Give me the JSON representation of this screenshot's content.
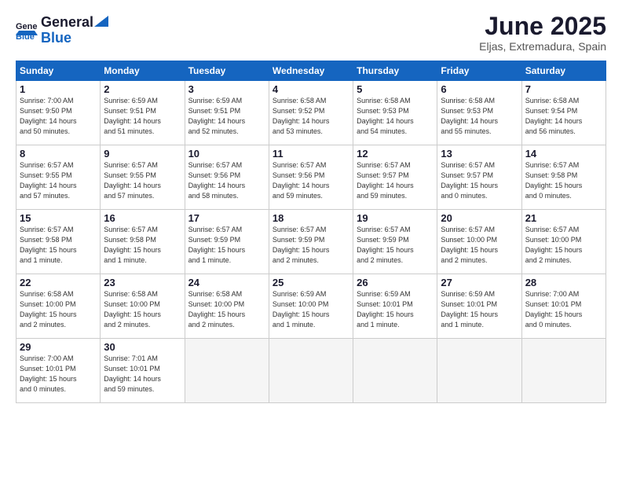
{
  "logo": {
    "general": "General",
    "blue": "Blue"
  },
  "title": "June 2025",
  "subtitle": "Eljas, Extremadura, Spain",
  "weekdays": [
    "Sunday",
    "Monday",
    "Tuesday",
    "Wednesday",
    "Thursday",
    "Friday",
    "Saturday"
  ],
  "weeks": [
    [
      {
        "day": "1",
        "info": "Sunrise: 7:00 AM\nSunset: 9:50 PM\nDaylight: 14 hours\nand 50 minutes."
      },
      {
        "day": "2",
        "info": "Sunrise: 6:59 AM\nSunset: 9:51 PM\nDaylight: 14 hours\nand 51 minutes."
      },
      {
        "day": "3",
        "info": "Sunrise: 6:59 AM\nSunset: 9:51 PM\nDaylight: 14 hours\nand 52 minutes."
      },
      {
        "day": "4",
        "info": "Sunrise: 6:58 AM\nSunset: 9:52 PM\nDaylight: 14 hours\nand 53 minutes."
      },
      {
        "day": "5",
        "info": "Sunrise: 6:58 AM\nSunset: 9:53 PM\nDaylight: 14 hours\nand 54 minutes."
      },
      {
        "day": "6",
        "info": "Sunrise: 6:58 AM\nSunset: 9:53 PM\nDaylight: 14 hours\nand 55 minutes."
      },
      {
        "day": "7",
        "info": "Sunrise: 6:58 AM\nSunset: 9:54 PM\nDaylight: 14 hours\nand 56 minutes."
      }
    ],
    [
      {
        "day": "8",
        "info": "Sunrise: 6:57 AM\nSunset: 9:55 PM\nDaylight: 14 hours\nand 57 minutes."
      },
      {
        "day": "9",
        "info": "Sunrise: 6:57 AM\nSunset: 9:55 PM\nDaylight: 14 hours\nand 57 minutes."
      },
      {
        "day": "10",
        "info": "Sunrise: 6:57 AM\nSunset: 9:56 PM\nDaylight: 14 hours\nand 58 minutes."
      },
      {
        "day": "11",
        "info": "Sunrise: 6:57 AM\nSunset: 9:56 PM\nDaylight: 14 hours\nand 59 minutes."
      },
      {
        "day": "12",
        "info": "Sunrise: 6:57 AM\nSunset: 9:57 PM\nDaylight: 14 hours\nand 59 minutes."
      },
      {
        "day": "13",
        "info": "Sunrise: 6:57 AM\nSunset: 9:57 PM\nDaylight: 15 hours\nand 0 minutes."
      },
      {
        "day": "14",
        "info": "Sunrise: 6:57 AM\nSunset: 9:58 PM\nDaylight: 15 hours\nand 0 minutes."
      }
    ],
    [
      {
        "day": "15",
        "info": "Sunrise: 6:57 AM\nSunset: 9:58 PM\nDaylight: 15 hours\nand 1 minute."
      },
      {
        "day": "16",
        "info": "Sunrise: 6:57 AM\nSunset: 9:58 PM\nDaylight: 15 hours\nand 1 minute."
      },
      {
        "day": "17",
        "info": "Sunrise: 6:57 AM\nSunset: 9:59 PM\nDaylight: 15 hours\nand 1 minute."
      },
      {
        "day": "18",
        "info": "Sunrise: 6:57 AM\nSunset: 9:59 PM\nDaylight: 15 hours\nand 2 minutes."
      },
      {
        "day": "19",
        "info": "Sunrise: 6:57 AM\nSunset: 9:59 PM\nDaylight: 15 hours\nand 2 minutes."
      },
      {
        "day": "20",
        "info": "Sunrise: 6:57 AM\nSunset: 10:00 PM\nDaylight: 15 hours\nand 2 minutes."
      },
      {
        "day": "21",
        "info": "Sunrise: 6:57 AM\nSunset: 10:00 PM\nDaylight: 15 hours\nand 2 minutes."
      }
    ],
    [
      {
        "day": "22",
        "info": "Sunrise: 6:58 AM\nSunset: 10:00 PM\nDaylight: 15 hours\nand 2 minutes."
      },
      {
        "day": "23",
        "info": "Sunrise: 6:58 AM\nSunset: 10:00 PM\nDaylight: 15 hours\nand 2 minutes."
      },
      {
        "day": "24",
        "info": "Sunrise: 6:58 AM\nSunset: 10:00 PM\nDaylight: 15 hours\nand 2 minutes."
      },
      {
        "day": "25",
        "info": "Sunrise: 6:59 AM\nSunset: 10:00 PM\nDaylight: 15 hours\nand 1 minute."
      },
      {
        "day": "26",
        "info": "Sunrise: 6:59 AM\nSunset: 10:01 PM\nDaylight: 15 hours\nand 1 minute."
      },
      {
        "day": "27",
        "info": "Sunrise: 6:59 AM\nSunset: 10:01 PM\nDaylight: 15 hours\nand 1 minute."
      },
      {
        "day": "28",
        "info": "Sunrise: 7:00 AM\nSunset: 10:01 PM\nDaylight: 15 hours\nand 0 minutes."
      }
    ],
    [
      {
        "day": "29",
        "info": "Sunrise: 7:00 AM\nSunset: 10:01 PM\nDaylight: 15 hours\nand 0 minutes."
      },
      {
        "day": "30",
        "info": "Sunrise: 7:01 AM\nSunset: 10:01 PM\nDaylight: 14 hours\nand 59 minutes."
      },
      {
        "day": "",
        "info": ""
      },
      {
        "day": "",
        "info": ""
      },
      {
        "day": "",
        "info": ""
      },
      {
        "day": "",
        "info": ""
      },
      {
        "day": "",
        "info": ""
      }
    ]
  ]
}
